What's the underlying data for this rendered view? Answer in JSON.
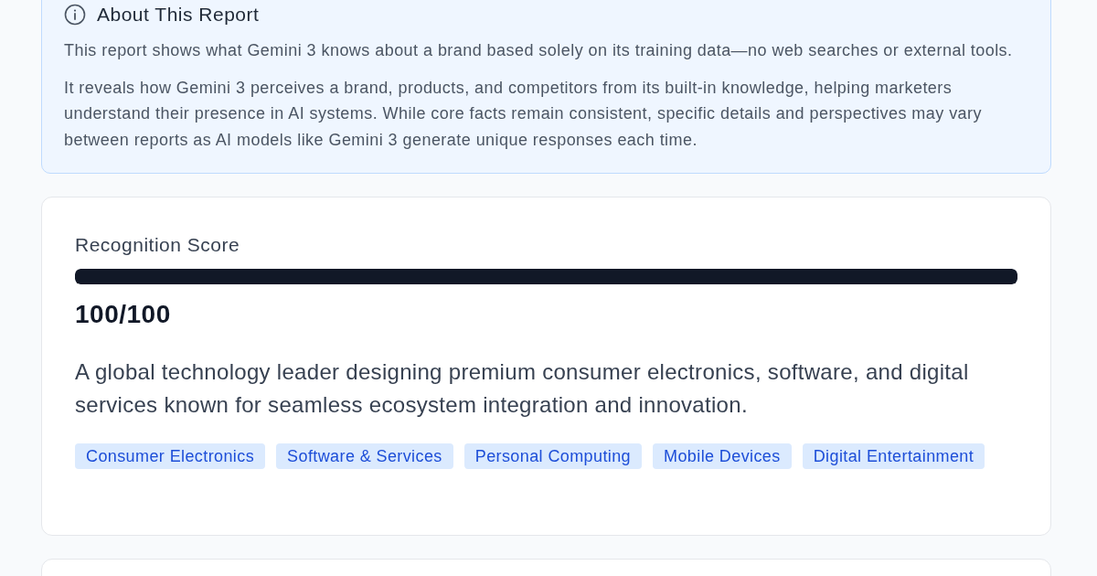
{
  "about": {
    "title": "About This Report",
    "paragraphs": [
      "This report shows what Gemini 3 knows about a brand based solely on its training data—no web searches or external tools.",
      "It reveals how Gemini 3 perceives a brand, products, and competitors from its built-in knowledge, helping marketers understand their presence in AI systems. While core facts remain consistent, specific details and perspectives may vary between reports as AI models like Gemini 3 generate unique responses each time."
    ]
  },
  "recognition": {
    "label": "Recognition Score",
    "level": 1,
    "score": "100/100",
    "description": "A global technology leader designing premium consumer electronics, software, and digital services known for seamless ecosystem integration and innovation.",
    "tags": [
      "Consumer Electronics",
      "Software & Services",
      "Personal Computing",
      "Mobile Devices",
      "Digital Entertainment"
    ]
  }
}
